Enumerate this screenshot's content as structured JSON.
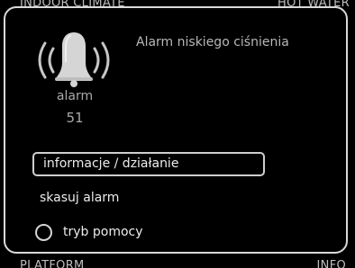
{
  "background": {
    "top_left": "INDOOR CLIMATE",
    "top_right": "HOT WATER",
    "bottom_left": "PLATFORM",
    "bottom_right": "INFO"
  },
  "alarm": {
    "title": "Alarm niskiego ciśnienia",
    "label": "alarm",
    "number": "51",
    "icon": "bell-alarm-icon"
  },
  "menu": {
    "selected_label": "informacje / działanie",
    "reset_label": "skasuj alarm",
    "help_label": "tryb pomocy"
  },
  "colors": {
    "background": "#000000",
    "border": "#d9d9d9",
    "text": "#ececec",
    "muted_text": "#b8b8b8"
  }
}
